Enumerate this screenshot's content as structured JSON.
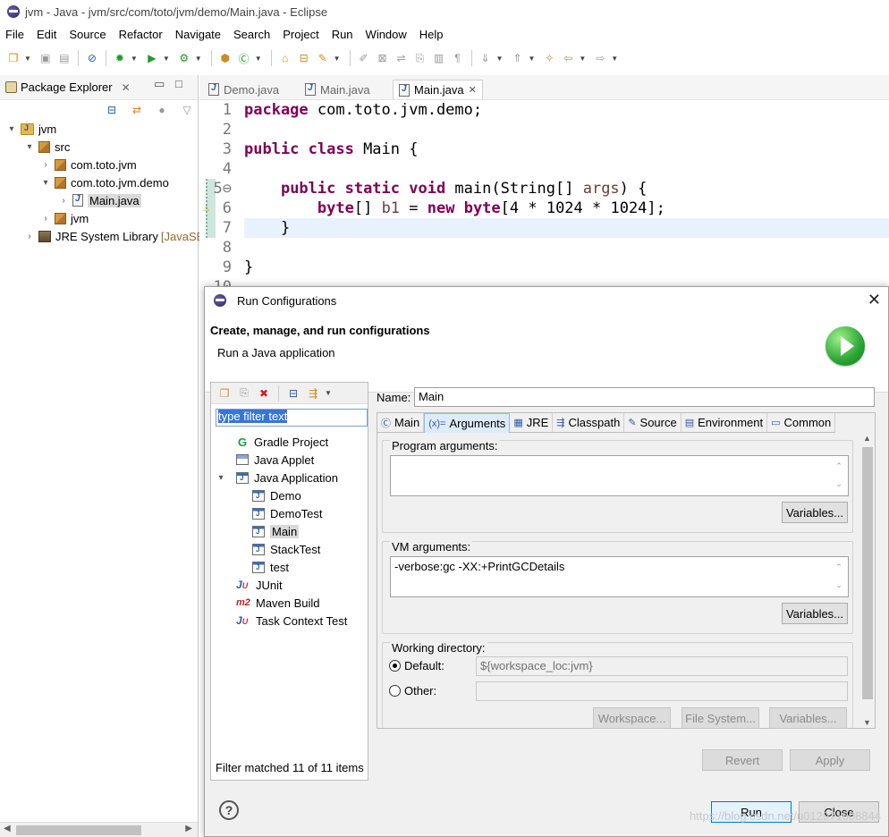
{
  "window": {
    "title": "jvm - Java - jvm/src/com/toto/jvm/demo/Main.java - Eclipse"
  },
  "menu": [
    "File",
    "Edit",
    "Source",
    "Refactor",
    "Navigate",
    "Search",
    "Project",
    "Run",
    "Window",
    "Help"
  ],
  "package_explorer": {
    "title": "Package Explorer",
    "tree": [
      {
        "label": "jvm",
        "twisty": "▾",
        "icon": "project-icon"
      },
      {
        "label": "src",
        "twisty": "▾",
        "icon": "source-folder-icon"
      },
      {
        "label": "com.toto.jvm",
        "twisty": "›",
        "icon": "package-icon"
      },
      {
        "label": "com.toto.jvm.demo",
        "twisty": "▾",
        "icon": "package-icon"
      },
      {
        "label": "Main.java",
        "twisty": "›",
        "icon": "java-file-icon"
      },
      {
        "label": "jvm",
        "twisty": "›",
        "icon": "package-icon"
      },
      {
        "label": "JRE System Library",
        "suffix": "[JavaSE",
        "twisty": "›",
        "icon": "library-icon"
      }
    ]
  },
  "editor": {
    "tabs": [
      "Demo.java",
      "Main.java",
      "Main.java"
    ],
    "lines": [
      {
        "n": "1",
        "html": "<span class='kw'>package</span> com.toto.jvm.demo;"
      },
      {
        "n": "2",
        "html": ""
      },
      {
        "n": "3",
        "html": "<span class='kw'>public class</span> Main {"
      },
      {
        "n": "4",
        "html": ""
      },
      {
        "n": "5⊖",
        "html": "    <span class='kw'>public static void</span> main(String[] <span class='var'>args</span>) {"
      },
      {
        "n": "6",
        "html": "        <span class='kw'>byte</span>[] <span class='var'>b1</span> = <span class='kw'>new byte</span>[4 * 1024 * 1024];"
      },
      {
        "n": "7",
        "html": "    }"
      },
      {
        "n": "8",
        "html": ""
      },
      {
        "n": "9",
        "html": "}"
      },
      {
        "n": "10",
        "html": ""
      }
    ]
  },
  "dialog": {
    "title": "Run Configurations",
    "header": "Create, manage, and run configurations",
    "subheader": "Run a Java application",
    "filter_placeholder": "type filter text",
    "config_tree": [
      {
        "label": "Gradle Project",
        "icon": "gradle-icon",
        "level": 0
      },
      {
        "label": "Java Applet",
        "icon": "java-applet-icon",
        "level": 0
      },
      {
        "label": "Java Application",
        "icon": "java-application-icon",
        "level": 0,
        "twisty": "▾"
      },
      {
        "label": "Demo",
        "icon": "java-application-icon",
        "level": 1
      },
      {
        "label": "DemoTest",
        "icon": "java-application-icon",
        "level": 1
      },
      {
        "label": "Main",
        "icon": "java-application-icon",
        "level": 1,
        "selected": true
      },
      {
        "label": "StackTest",
        "icon": "java-application-icon",
        "level": 1
      },
      {
        "label": "test",
        "icon": "java-application-icon",
        "level": 1
      },
      {
        "label": "JUnit",
        "icon": "junit-icon",
        "level": 0
      },
      {
        "label": "Maven Build",
        "icon": "maven-icon",
        "level": 0
      },
      {
        "label": "Task Context Test",
        "icon": "task-context-icon",
        "level": 0
      }
    ],
    "filter_status": "Filter matched 11 of 11 items",
    "name_label": "Name:",
    "name_value": "Main",
    "tabs": [
      {
        "label": "Main",
        "icon": "main-tab-icon"
      },
      {
        "label": "Arguments",
        "icon": "arguments-tab-icon",
        "active": true
      },
      {
        "label": "JRE",
        "icon": "jre-tab-icon"
      },
      {
        "label": "Classpath",
        "icon": "classpath-tab-icon"
      },
      {
        "label": "Source",
        "icon": "source-tab-icon"
      },
      {
        "label": "Environment",
        "icon": "environment-tab-icon"
      },
      {
        "label": "Common",
        "icon": "common-tab-icon"
      }
    ],
    "program_args_label": "Program arguments:",
    "program_args_value": "",
    "variables_label": "Variables...",
    "vm_args_label": "VM arguments:",
    "vm_args_value": "-verbose:gc -XX:+PrintGCDetails",
    "working_dir_label": "Working directory:",
    "default_label": "Default:",
    "default_value": "${workspace_loc:jvm}",
    "other_label": "Other:",
    "workspace_btn": "Workspace...",
    "filesystem_btn": "File System...",
    "revert_btn": "Revert",
    "apply_btn": "Apply",
    "run_btn": "Run",
    "close_btn": "Close",
    "watermark": "https://blog.csdn.net/u012971608844"
  }
}
